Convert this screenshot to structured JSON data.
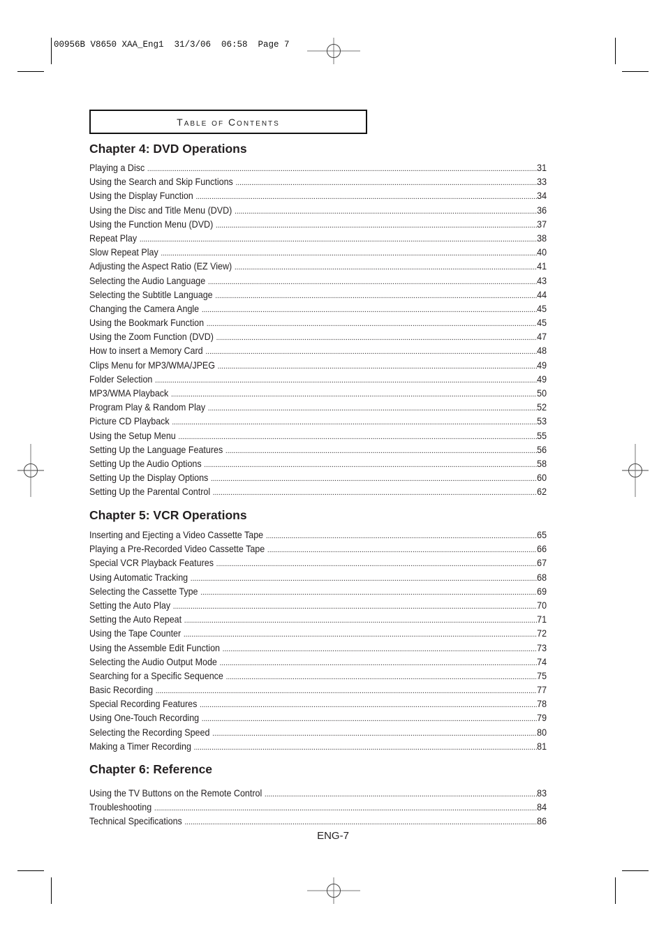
{
  "slug_line": "00956B V8650 XAA_Eng1  31/3/06  06:58  Page 7",
  "toc_title": "Table of Contents",
  "chapters": [
    {
      "title": "Chapter 4: DVD Operations",
      "entries": [
        {
          "title": "Playing a Disc",
          "page": "31"
        },
        {
          "title": "Using the Search and Skip Functions",
          "page": "33"
        },
        {
          "title": "Using the Display Function",
          "page": "34"
        },
        {
          "title": "Using the Disc and Title Menu (DVD)",
          "page": "36"
        },
        {
          "title": "Using the Function Menu (DVD)",
          "page": "37"
        },
        {
          "title": "Repeat Play",
          "page": "38"
        },
        {
          "title": "Slow Repeat Play",
          "page": "40"
        },
        {
          "title": "Adjusting the Aspect Ratio (EZ View)",
          "page": "41"
        },
        {
          "title": "Selecting the Audio Language",
          "page": "43"
        },
        {
          "title": "Selecting the Subtitle Language",
          "page": "44"
        },
        {
          "title": "Changing the Camera Angle",
          "page": "45"
        },
        {
          "title": "Using the Bookmark Function",
          "page": "45"
        },
        {
          "title": "Using the Zoom Function (DVD)",
          "page": "47"
        },
        {
          "title": "How to insert a Memory Card",
          "page": "48"
        },
        {
          "title": "Clips Menu for MP3/WMA/JPEG",
          "page": "49"
        },
        {
          "title": "Folder Selection",
          "page": "49"
        },
        {
          "title": "MP3/WMA Playback",
          "page": "50"
        },
        {
          "title": "Program Play & Random Play",
          "page": "52"
        },
        {
          "title": "Picture CD Playback",
          "page": "53"
        },
        {
          "title": "Using the Setup Menu",
          "page": "55"
        },
        {
          "title": "Setting Up the Language Features",
          "page": "56"
        },
        {
          "title": "Setting Up the Audio Options",
          "page": "58"
        },
        {
          "title": "Setting Up the Display Options",
          "page": "60"
        },
        {
          "title": "Setting Up the Parental Control",
          "page": "62"
        }
      ]
    },
    {
      "title": "Chapter 5: VCR Operations",
      "entries": [
        {
          "title": "Inserting and Ejecting a Video Cassette Tape",
          "page": "65"
        },
        {
          "title": "Playing a Pre-Recorded Video Cassette Tape",
          "page": "66"
        },
        {
          "title": "Special VCR Playback Features",
          "page": "67"
        },
        {
          "title": "Using Automatic Tracking",
          "page": "68"
        },
        {
          "title": "Selecting the Cassette Type",
          "page": "69"
        },
        {
          "title": "Setting the Auto Play",
          "page": "70"
        },
        {
          "title": "Setting the Auto Repeat",
          "page": "71"
        },
        {
          "title": "Using the Tape Counter",
          "page": "72"
        },
        {
          "title": "Using the Assemble Edit Function",
          "page": "73"
        },
        {
          "title": "Selecting the Audio Output Mode",
          "page": "74"
        },
        {
          "title": "Searching for a Specific Sequence",
          "page": "75"
        },
        {
          "title": "Basic Recording",
          "page": "77"
        },
        {
          "title": "Special Recording Features",
          "page": "78"
        },
        {
          "title": "Using One-Touch Recording",
          "page": "79"
        },
        {
          "title": "Selecting the Recording Speed",
          "page": "80"
        },
        {
          "title": "Making a Timer Recording",
          "page": "81"
        }
      ]
    },
    {
      "title": "Chapter 6: Reference",
      "entries": [
        {
          "title": "Using the TV Buttons on the Remote Control",
          "page": "83"
        },
        {
          "title": "Troubleshooting",
          "page": "84"
        },
        {
          "title": "Technical Specifications",
          "page": "86"
        }
      ]
    }
  ],
  "footer_page": "ENG-7",
  "icons": {
    "registration_mark": "registration-mark-icon",
    "crop_mark": "crop-mark-icon"
  }
}
